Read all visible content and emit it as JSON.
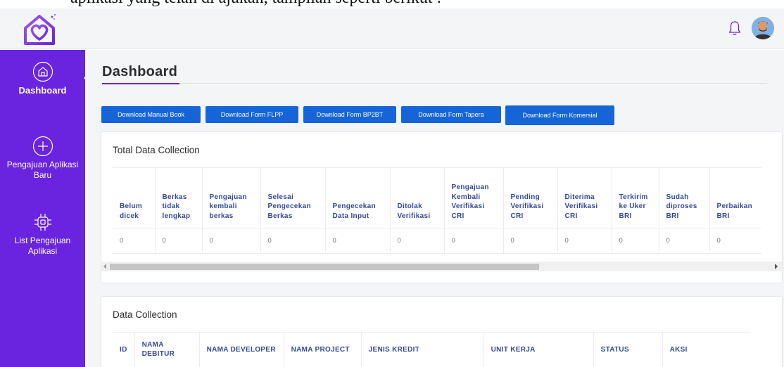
{
  "doc_fragment": "aplikasi yang telah di ajukan, tampilan seperti berikut :",
  "header": {
    "logo_icon": "home-heart-logo-icon",
    "notification_icon": "bell-icon",
    "avatar_icon": "user-avatar-icon"
  },
  "sidebar": {
    "items": [
      {
        "label": "Dashboard",
        "icon": "home-icon",
        "active": true
      },
      {
        "label": "Pengajuan Aplikasi Baru",
        "icon": "plus-circle-icon"
      },
      {
        "label": "List Pengajuan Aplikasi",
        "icon": "chip-icon"
      }
    ]
  },
  "page": {
    "title": "Dashboard"
  },
  "buttons": [
    {
      "label": "Download Manual Book"
    },
    {
      "label": "Download Form FLPP"
    },
    {
      "label": "Download Form BP2BT"
    },
    {
      "label": "Download Form Tapera"
    },
    {
      "label": "Download Form Komersial"
    }
  ],
  "total_data_collection": {
    "title": "Total Data Collection",
    "headers": [
      "Belum dicek",
      "Berkas tidak lengkap",
      "Pengajuan kembali berkas",
      "Selesai Pengecekan Berkas",
      "Pengecekan Data Input",
      "Ditolak Verifikasi",
      "Pengajuan Kembali Verifikasi CRI",
      "Pending Verifikasi CRI",
      "Diterima Verifikasi CRI",
      "Terkirim ke Uker BRI",
      "Sudah diproses BRI",
      "Perbaikan BRI"
    ],
    "values": [
      "0",
      "0",
      "0",
      "0",
      "0",
      "0",
      "0",
      "0",
      "0",
      "0",
      "0",
      "0"
    ]
  },
  "data_collection": {
    "title": "Data Collection",
    "headers": [
      "ID",
      "NAMA DEBITUR",
      "NAMA DEVELOPER",
      "NAMA PROJECT",
      "JENIS KREDIT",
      "UNIT KERJA",
      "STATUS",
      "AKSI"
    ]
  },
  "colors": {
    "sidebar": "#6a24e0",
    "button": "#1565d8",
    "header_text": "#34489c"
  }
}
